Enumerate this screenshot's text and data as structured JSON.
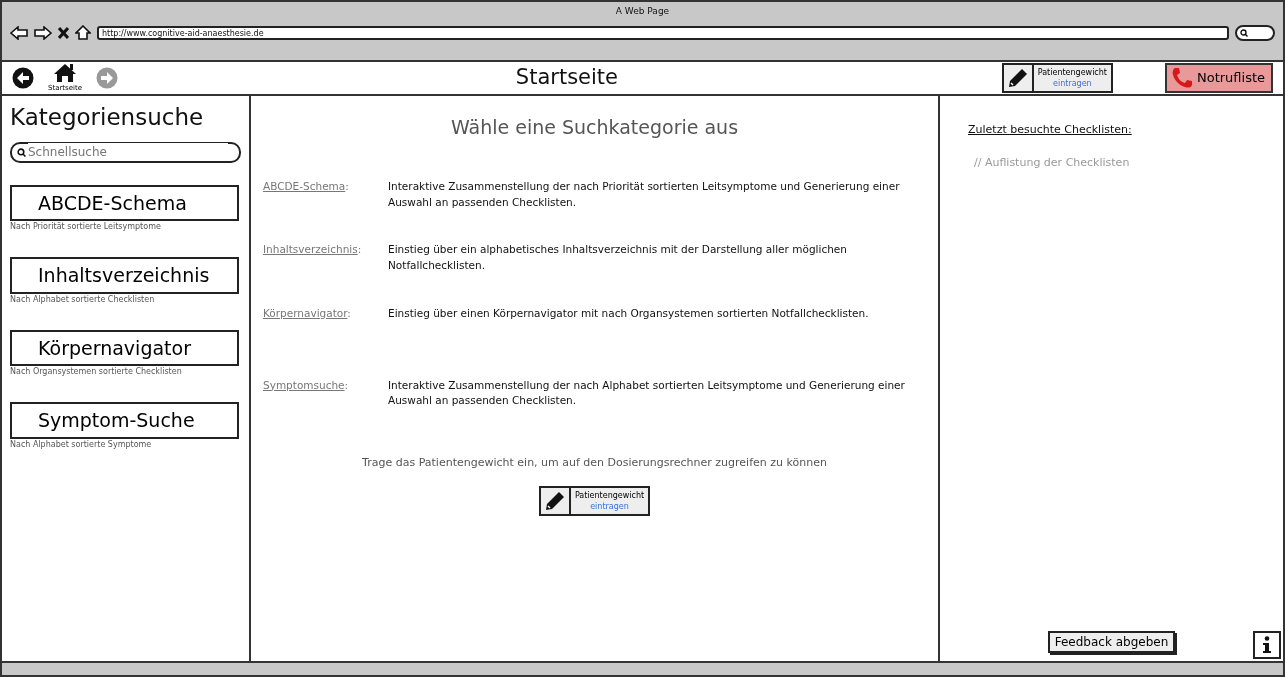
{
  "window": {
    "title": "A Web Page"
  },
  "address_bar": {
    "url": "http://www.cognitive-aid-anaesthesie.de"
  },
  "nav_buttons": [
    {
      "kind": "back",
      "disabled": false
    },
    {
      "kind": "home",
      "label": "Startseite",
      "disabled": false
    },
    {
      "kind": "forward",
      "disabled": true
    }
  ],
  "header": {
    "title": "Startseite",
    "weight_button": {
      "line_1": "Patientengewicht",
      "line_2": "eintragen"
    },
    "emergency_button": "Notrufliste"
  },
  "sidebar": {
    "title": "Kategoriensuche",
    "search": {
      "placeholder": "Schnellsuche"
    },
    "categories": [
      {
        "label": "ABCDE-Schema",
        "description": "Nach Priorität sortierte Leitsymptome"
      },
      {
        "label": "Inhaltsverzeichnis",
        "description": "Nach Alphabet sortierte Checklisten"
      },
      {
        "label": "Körpernavigator",
        "description": "Nach Organsystemen sortierte Checklisten"
      },
      {
        "label": "Symptom-Suche",
        "description": "Nach Alphabet sortierte Symptome"
      }
    ]
  },
  "main": {
    "heading": "Wähle eine Suchkategorie aus",
    "entries": [
      {
        "link": "ABCDE-Schema",
        "separator": ":",
        "description": "Interaktive Zusammenstellung der nach Priorität sortierten Leitsymptome und Generierung einer Auswahl an passenden Checklisten."
      },
      {
        "link": "Inhaltsverzeichnis",
        "separator": ":",
        "description": "Einstieg über ein alphabetisches Inhaltsverzeichnis mit der Darstellung aller möglichen Notfallchecklisten."
      },
      {
        "link": "Körpernavigator",
        "separator": ":",
        "description": "Einstieg über einen Körpernavigator mit nach Organsystemen sortierten Notfallchecklisten."
      },
      {
        "link": "Symptomsuche",
        "separator": ":",
        "description": "Interaktive Zusammenstellung der nach Alphabet sortierten Leitsymptome und Generierung einer Auswahl an passenden Checklisten."
      }
    ],
    "hint": "Trage das Patientengewicht ein, um auf den Dosierungsrechner zugreifen zu können",
    "weight_button": {
      "line_1": "Patientengewicht",
      "line_2": "eintragen"
    }
  },
  "recent": {
    "heading": "Zuletzt besuchte Checklisten:",
    "placeholder_text": "// Auflistung der Checklisten",
    "feedback_button": "Feedback abgeben"
  }
}
